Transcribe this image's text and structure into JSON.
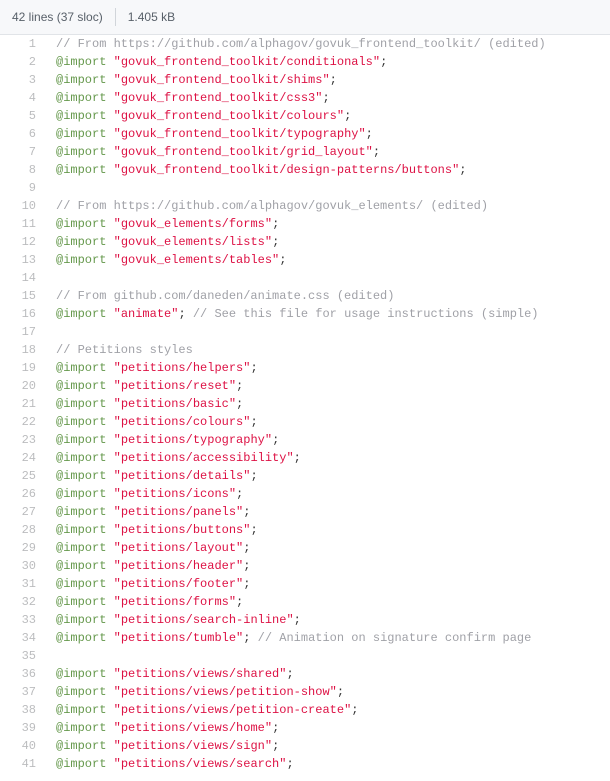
{
  "header": {
    "lines_label": "42 lines (37 sloc)",
    "file_size": "1.405 kB"
  },
  "code": {
    "lines": [
      {
        "n": 1,
        "tokens": [
          {
            "t": "comment",
            "v": "// From https://github.com/alphagov/govuk_frontend_toolkit/ (edited)"
          }
        ]
      },
      {
        "n": 2,
        "tokens": [
          {
            "t": "keyword",
            "v": "@import"
          },
          {
            "t": "plain",
            "v": " "
          },
          {
            "t": "string",
            "v": "\"govuk_frontend_toolkit/conditionals\""
          },
          {
            "t": "semi",
            "v": ";"
          }
        ]
      },
      {
        "n": 3,
        "tokens": [
          {
            "t": "keyword",
            "v": "@import"
          },
          {
            "t": "plain",
            "v": " "
          },
          {
            "t": "string",
            "v": "\"govuk_frontend_toolkit/shims\""
          },
          {
            "t": "semi",
            "v": ";"
          }
        ]
      },
      {
        "n": 4,
        "tokens": [
          {
            "t": "keyword",
            "v": "@import"
          },
          {
            "t": "plain",
            "v": " "
          },
          {
            "t": "string",
            "v": "\"govuk_frontend_toolkit/css3\""
          },
          {
            "t": "semi",
            "v": ";"
          }
        ]
      },
      {
        "n": 5,
        "tokens": [
          {
            "t": "keyword",
            "v": "@import"
          },
          {
            "t": "plain",
            "v": " "
          },
          {
            "t": "string",
            "v": "\"govuk_frontend_toolkit/colours\""
          },
          {
            "t": "semi",
            "v": ";"
          }
        ]
      },
      {
        "n": 6,
        "tokens": [
          {
            "t": "keyword",
            "v": "@import"
          },
          {
            "t": "plain",
            "v": " "
          },
          {
            "t": "string",
            "v": "\"govuk_frontend_toolkit/typography\""
          },
          {
            "t": "semi",
            "v": ";"
          }
        ]
      },
      {
        "n": 7,
        "tokens": [
          {
            "t": "keyword",
            "v": "@import"
          },
          {
            "t": "plain",
            "v": " "
          },
          {
            "t": "string",
            "v": "\"govuk_frontend_toolkit/grid_layout\""
          },
          {
            "t": "semi",
            "v": ";"
          }
        ]
      },
      {
        "n": 8,
        "tokens": [
          {
            "t": "keyword",
            "v": "@import"
          },
          {
            "t": "plain",
            "v": " "
          },
          {
            "t": "string",
            "v": "\"govuk_frontend_toolkit/design-patterns/buttons\""
          },
          {
            "t": "semi",
            "v": ";"
          }
        ]
      },
      {
        "n": 9,
        "tokens": []
      },
      {
        "n": 10,
        "tokens": [
          {
            "t": "comment",
            "v": "// From https://github.com/alphagov/govuk_elements/ (edited)"
          }
        ]
      },
      {
        "n": 11,
        "tokens": [
          {
            "t": "keyword",
            "v": "@import"
          },
          {
            "t": "plain",
            "v": " "
          },
          {
            "t": "string",
            "v": "\"govuk_elements/forms\""
          },
          {
            "t": "semi",
            "v": ";"
          }
        ]
      },
      {
        "n": 12,
        "tokens": [
          {
            "t": "keyword",
            "v": "@import"
          },
          {
            "t": "plain",
            "v": " "
          },
          {
            "t": "string",
            "v": "\"govuk_elements/lists\""
          },
          {
            "t": "semi",
            "v": ";"
          }
        ]
      },
      {
        "n": 13,
        "tokens": [
          {
            "t": "keyword",
            "v": "@import"
          },
          {
            "t": "plain",
            "v": " "
          },
          {
            "t": "string",
            "v": "\"govuk_elements/tables\""
          },
          {
            "t": "semi",
            "v": ";"
          }
        ]
      },
      {
        "n": 14,
        "tokens": []
      },
      {
        "n": 15,
        "tokens": [
          {
            "t": "comment",
            "v": "// From github.com/daneden/animate.css (edited)"
          }
        ]
      },
      {
        "n": 16,
        "tokens": [
          {
            "t": "keyword",
            "v": "@import"
          },
          {
            "t": "plain",
            "v": " "
          },
          {
            "t": "string",
            "v": "\"animate\""
          },
          {
            "t": "semi",
            "v": ";"
          },
          {
            "t": "plain",
            "v": " "
          },
          {
            "t": "comment",
            "v": "// See this file for usage instructions (simple)"
          }
        ]
      },
      {
        "n": 17,
        "tokens": []
      },
      {
        "n": 18,
        "tokens": [
          {
            "t": "comment",
            "v": "// Petitions styles"
          }
        ]
      },
      {
        "n": 19,
        "tokens": [
          {
            "t": "keyword",
            "v": "@import"
          },
          {
            "t": "plain",
            "v": " "
          },
          {
            "t": "string",
            "v": "\"petitions/helpers\""
          },
          {
            "t": "semi",
            "v": ";"
          }
        ]
      },
      {
        "n": 20,
        "tokens": [
          {
            "t": "keyword",
            "v": "@import"
          },
          {
            "t": "plain",
            "v": " "
          },
          {
            "t": "string",
            "v": "\"petitions/reset\""
          },
          {
            "t": "semi",
            "v": ";"
          }
        ]
      },
      {
        "n": 21,
        "tokens": [
          {
            "t": "keyword",
            "v": "@import"
          },
          {
            "t": "plain",
            "v": " "
          },
          {
            "t": "string",
            "v": "\"petitions/basic\""
          },
          {
            "t": "semi",
            "v": ";"
          }
        ]
      },
      {
        "n": 22,
        "tokens": [
          {
            "t": "keyword",
            "v": "@import"
          },
          {
            "t": "plain",
            "v": " "
          },
          {
            "t": "string",
            "v": "\"petitions/colours\""
          },
          {
            "t": "semi",
            "v": ";"
          }
        ]
      },
      {
        "n": 23,
        "tokens": [
          {
            "t": "keyword",
            "v": "@import"
          },
          {
            "t": "plain",
            "v": " "
          },
          {
            "t": "string",
            "v": "\"petitions/typography\""
          },
          {
            "t": "semi",
            "v": ";"
          }
        ]
      },
      {
        "n": 24,
        "tokens": [
          {
            "t": "keyword",
            "v": "@import"
          },
          {
            "t": "plain",
            "v": " "
          },
          {
            "t": "string",
            "v": "\"petitions/accessibility\""
          },
          {
            "t": "semi",
            "v": ";"
          }
        ]
      },
      {
        "n": 25,
        "tokens": [
          {
            "t": "keyword",
            "v": "@import"
          },
          {
            "t": "plain",
            "v": " "
          },
          {
            "t": "string",
            "v": "\"petitions/details\""
          },
          {
            "t": "semi",
            "v": ";"
          }
        ]
      },
      {
        "n": 26,
        "tokens": [
          {
            "t": "keyword",
            "v": "@import"
          },
          {
            "t": "plain",
            "v": " "
          },
          {
            "t": "string",
            "v": "\"petitions/icons\""
          },
          {
            "t": "semi",
            "v": ";"
          }
        ]
      },
      {
        "n": 27,
        "tokens": [
          {
            "t": "keyword",
            "v": "@import"
          },
          {
            "t": "plain",
            "v": " "
          },
          {
            "t": "string",
            "v": "\"petitions/panels\""
          },
          {
            "t": "semi",
            "v": ";"
          }
        ]
      },
      {
        "n": 28,
        "tokens": [
          {
            "t": "keyword",
            "v": "@import"
          },
          {
            "t": "plain",
            "v": " "
          },
          {
            "t": "string",
            "v": "\"petitions/buttons\""
          },
          {
            "t": "semi",
            "v": ";"
          }
        ]
      },
      {
        "n": 29,
        "tokens": [
          {
            "t": "keyword",
            "v": "@import"
          },
          {
            "t": "plain",
            "v": " "
          },
          {
            "t": "string",
            "v": "\"petitions/layout\""
          },
          {
            "t": "semi",
            "v": ";"
          }
        ]
      },
      {
        "n": 30,
        "tokens": [
          {
            "t": "keyword",
            "v": "@import"
          },
          {
            "t": "plain",
            "v": " "
          },
          {
            "t": "string",
            "v": "\"petitions/header\""
          },
          {
            "t": "semi",
            "v": ";"
          }
        ]
      },
      {
        "n": 31,
        "tokens": [
          {
            "t": "keyword",
            "v": "@import"
          },
          {
            "t": "plain",
            "v": " "
          },
          {
            "t": "string",
            "v": "\"petitions/footer\""
          },
          {
            "t": "semi",
            "v": ";"
          }
        ]
      },
      {
        "n": 32,
        "tokens": [
          {
            "t": "keyword",
            "v": "@import"
          },
          {
            "t": "plain",
            "v": " "
          },
          {
            "t": "string",
            "v": "\"petitions/forms\""
          },
          {
            "t": "semi",
            "v": ";"
          }
        ]
      },
      {
        "n": 33,
        "tokens": [
          {
            "t": "keyword",
            "v": "@import"
          },
          {
            "t": "plain",
            "v": " "
          },
          {
            "t": "string",
            "v": "\"petitions/search-inline\""
          },
          {
            "t": "semi",
            "v": ";"
          }
        ]
      },
      {
        "n": 34,
        "tokens": [
          {
            "t": "keyword",
            "v": "@import"
          },
          {
            "t": "plain",
            "v": " "
          },
          {
            "t": "string",
            "v": "\"petitions/tumble\""
          },
          {
            "t": "semi",
            "v": ";"
          },
          {
            "t": "plain",
            "v": " "
          },
          {
            "t": "comment",
            "v": "// Animation on signature confirm page"
          }
        ]
      },
      {
        "n": 35,
        "tokens": []
      },
      {
        "n": 36,
        "tokens": [
          {
            "t": "keyword",
            "v": "@import"
          },
          {
            "t": "plain",
            "v": " "
          },
          {
            "t": "string",
            "v": "\"petitions/views/shared\""
          },
          {
            "t": "semi",
            "v": ";"
          }
        ]
      },
      {
        "n": 37,
        "tokens": [
          {
            "t": "keyword",
            "v": "@import"
          },
          {
            "t": "plain",
            "v": " "
          },
          {
            "t": "string",
            "v": "\"petitions/views/petition-show\""
          },
          {
            "t": "semi",
            "v": ";"
          }
        ]
      },
      {
        "n": 38,
        "tokens": [
          {
            "t": "keyword",
            "v": "@import"
          },
          {
            "t": "plain",
            "v": " "
          },
          {
            "t": "string",
            "v": "\"petitions/views/petition-create\""
          },
          {
            "t": "semi",
            "v": ";"
          }
        ]
      },
      {
        "n": 39,
        "tokens": [
          {
            "t": "keyword",
            "v": "@import"
          },
          {
            "t": "plain",
            "v": " "
          },
          {
            "t": "string",
            "v": "\"petitions/views/home\""
          },
          {
            "t": "semi",
            "v": ";"
          }
        ]
      },
      {
        "n": 40,
        "tokens": [
          {
            "t": "keyword",
            "v": "@import"
          },
          {
            "t": "plain",
            "v": " "
          },
          {
            "t": "string",
            "v": "\"petitions/views/sign\""
          },
          {
            "t": "semi",
            "v": ";"
          }
        ]
      },
      {
        "n": 41,
        "tokens": [
          {
            "t": "keyword",
            "v": "@import"
          },
          {
            "t": "plain",
            "v": " "
          },
          {
            "t": "string",
            "v": "\"petitions/views/search\""
          },
          {
            "t": "semi",
            "v": ";"
          }
        ]
      }
    ]
  }
}
